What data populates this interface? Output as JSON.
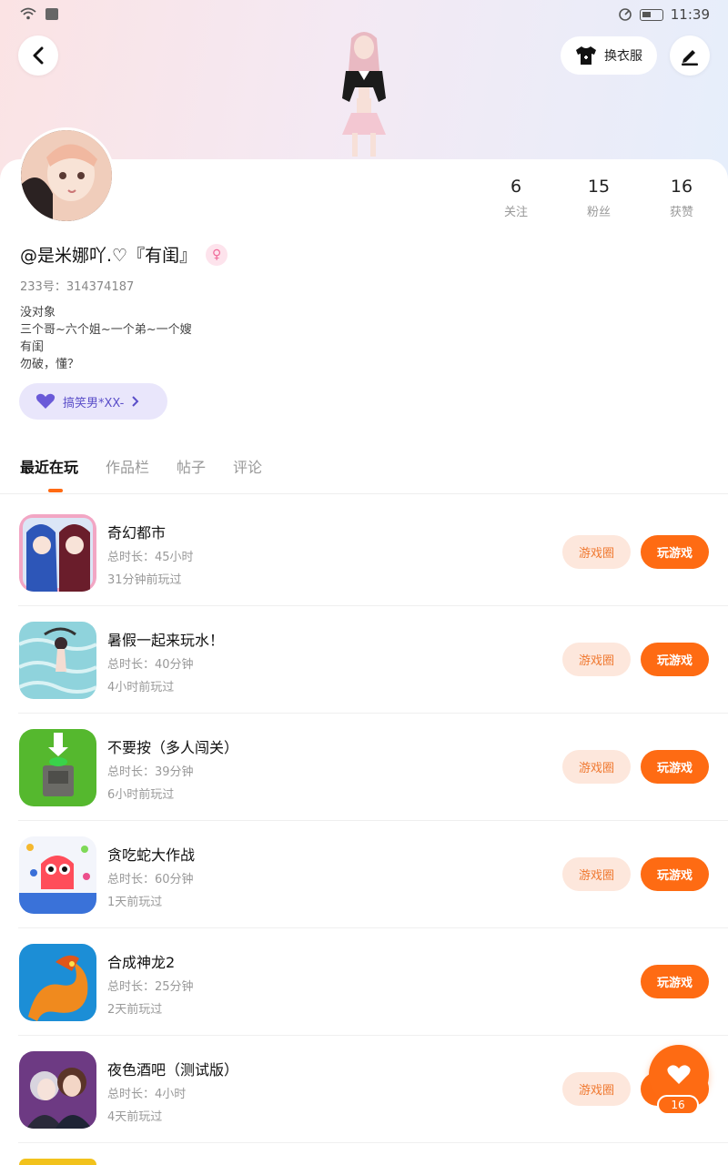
{
  "status_bar": {
    "time": "11:39"
  },
  "header": {
    "outfit_button_label": "换衣服",
    "colors": {
      "hero_left": "#fbe3e4",
      "hero_right": "#e6eefb"
    }
  },
  "profile": {
    "username": "@是米娜吖.♡『有闺』",
    "gender_symbol": "♀",
    "uid": "233号：314374187",
    "bio_lines": [
      "没对象",
      "三个哥~六个姐~一个弟~一个嫂",
      "有闺",
      "勿破，懂？"
    ],
    "tag_label": "搞笑男*XX-",
    "stats": [
      {
        "count": "6",
        "label": "关注"
      },
      {
        "count": "15",
        "label": "粉丝"
      },
      {
        "count": "16",
        "label": "获赞"
      }
    ]
  },
  "tabs": [
    "最近在玩",
    "作品栏",
    "帖子",
    "评论"
  ],
  "games": [
    {
      "title": "奇幻都市",
      "duration": "总时长：45小时",
      "last_played": "31分钟前玩过",
      "circle_label": "游戏圈",
      "play_label": "玩游戏",
      "icon_colors": [
        "#3b66c9",
        "#f4a7c8"
      ]
    },
    {
      "title": "暑假一起来玩水！",
      "duration": "总时长：40分钟",
      "last_played": "4小时前玩过",
      "circle_label": "游戏圈",
      "play_label": "玩游戏",
      "icon_colors": [
        "#79c7d6",
        "#bfe8ee"
      ]
    },
    {
      "title": "不要按（多人闯关）",
      "duration": "总时长：39分钟",
      "last_played": "6小时前玩过",
      "circle_label": "游戏圈",
      "play_label": "玩游戏",
      "icon_colors": [
        "#4db32a",
        "#6fd03c"
      ]
    },
    {
      "title": "贪吃蛇大作战",
      "duration": "总时长：60分钟",
      "last_played": "1天前玩过",
      "circle_label": "游戏圈",
      "play_label": "玩游戏",
      "icon_colors": [
        "#f2f4fb",
        "#3a6fd8"
      ]
    },
    {
      "title": "合成神龙2",
      "duration": "总时长：25分钟",
      "last_played": "2天前玩过",
      "circle_label": "",
      "play_label": "玩游戏",
      "icon_colors": [
        "#1d8fd6",
        "#f08a1e"
      ]
    },
    {
      "title": "夜色酒吧（测试版）",
      "duration": "总时长：4小时",
      "last_played": "4天前玩过",
      "circle_label": "游戏圈",
      "play_label": "玩游戏",
      "icon_colors": [
        "#7b3f8f",
        "#c9a3d6"
      ]
    }
  ],
  "fab": {
    "count": "16"
  },
  "accent": "#fe6b13"
}
